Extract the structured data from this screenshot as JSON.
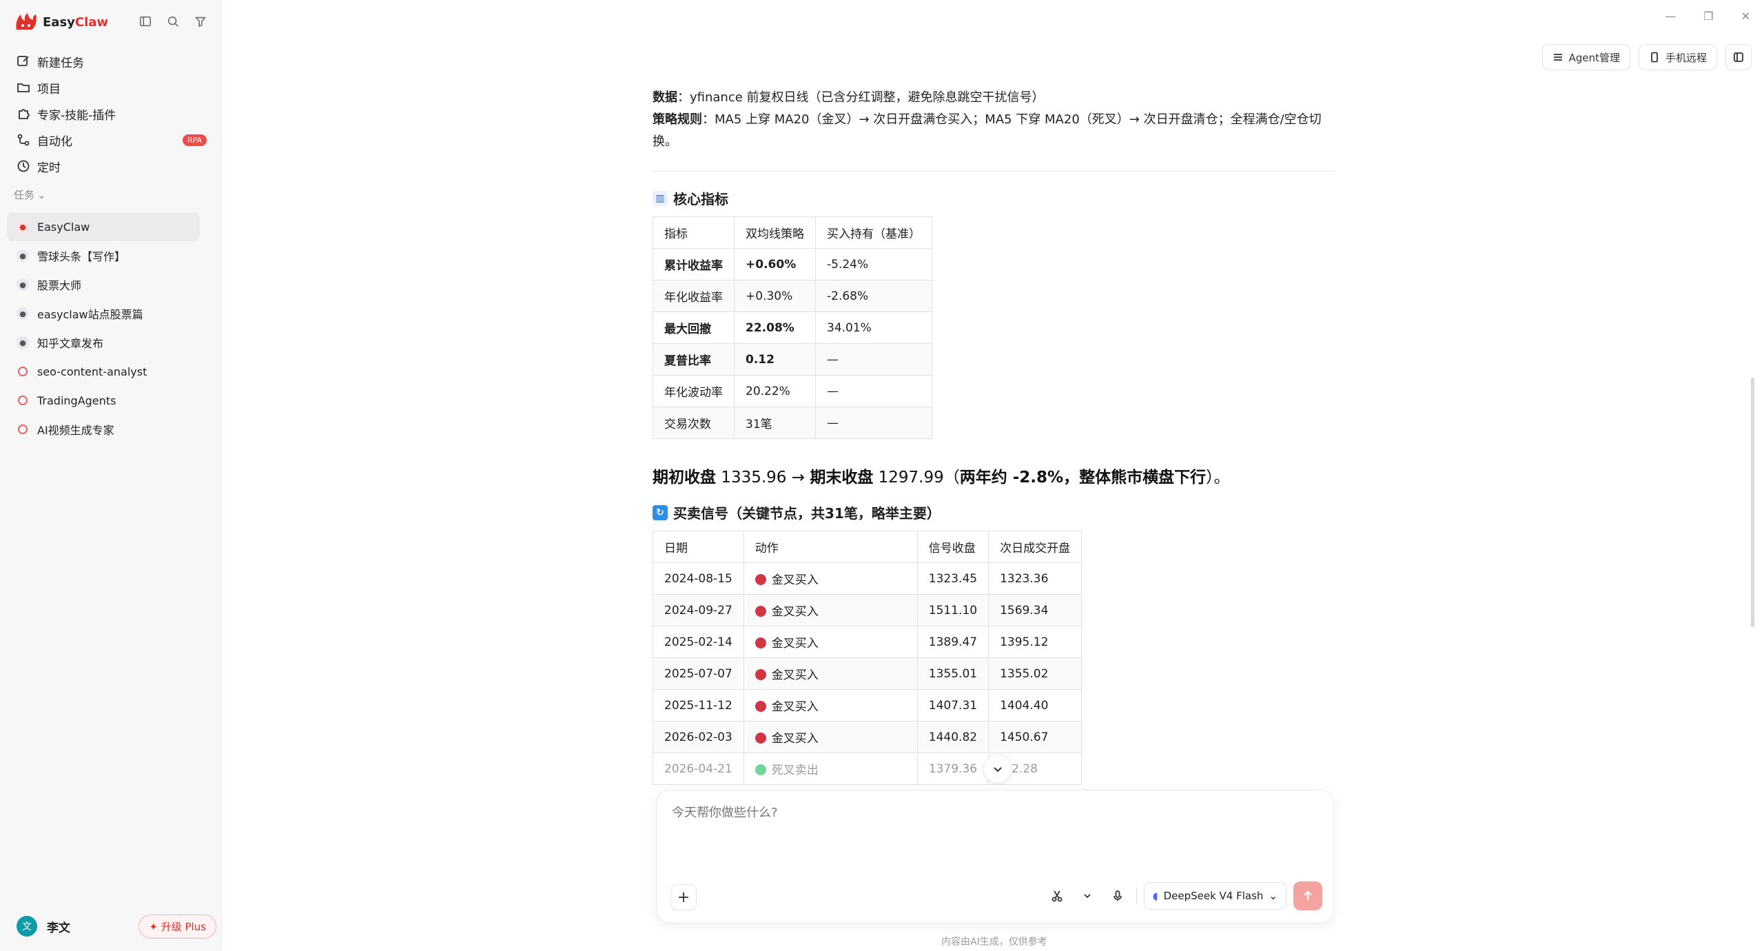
{
  "brand": {
    "name_a": "Easy",
    "name_b": "Claw"
  },
  "nav": [
    {
      "label": "新建任务",
      "icon": "new-task-icon"
    },
    {
      "label": "项目",
      "icon": "folder-icon"
    },
    {
      "label": "专家-技能-插件",
      "icon": "puzzle-icon"
    },
    {
      "label": "自动化",
      "icon": "automation-icon",
      "badge": "RPA"
    },
    {
      "label": "定时",
      "icon": "clock-icon"
    }
  ],
  "tasks_section_label": "任务",
  "tasks": [
    {
      "label": "EasyClaw",
      "avatar": "claw"
    },
    {
      "label": "雪球头条【写作】",
      "avatar": "person"
    },
    {
      "label": "股票大师",
      "avatar": "person"
    },
    {
      "label": "easyclaw站点股票篇",
      "avatar": "person"
    },
    {
      "label": "知乎文章发布",
      "avatar": "person"
    },
    {
      "label": "seo-content-analyst",
      "avatar": "dot"
    },
    {
      "label": "TradingAgents",
      "avatar": "dot"
    },
    {
      "label": "AI视频生成专家",
      "avatar": "dot"
    }
  ],
  "user": {
    "avatar_text": "文",
    "name": "李文",
    "upgrade": "升级 Plus"
  },
  "top_actions": {
    "agent": "Agent管理",
    "phone": "手机远程"
  },
  "content": {
    "data_label": "数据",
    "data_text": "：yfinance 前复权日线（已含分红调整，避免除息跳空干扰信号）",
    "rule_label": "策略规则",
    "rule_text": "：MA5 上穿 MA20（金叉）→ 次日开盘满仓买入；MA5 下穿 MA20（死叉）→ 次日开盘清仓；全程满仓/空仓切换。",
    "core_title": "核心指标",
    "core_headers": [
      "指标",
      "双均线策略",
      "买入持有（基准）"
    ],
    "core_rows": [
      {
        "cells": [
          "累计收益率",
          "+0.60%",
          "-5.24%"
        ],
        "bold": true
      },
      {
        "cells": [
          "年化收益率",
          "+0.30%",
          "-2.68%"
        ],
        "bold": false
      },
      {
        "cells": [
          "最大回撤",
          "22.08%",
          "34.01%"
        ],
        "bold": true
      },
      {
        "cells": [
          "夏普比率",
          "0.12",
          "—"
        ],
        "bold": true
      },
      {
        "cells": [
          "年化波动率",
          "20.22%",
          "—"
        ],
        "bold": false
      },
      {
        "cells": [
          "交易次数",
          "31笔",
          "—"
        ],
        "bold": false
      }
    ],
    "summary_a": "期初收盘",
    "summary_b": " 1335.96 → ",
    "summary_c": "期末收盘",
    "summary_d": " 1297.99（",
    "summary_e": "两年约 -2.8%，整体熊市横盘下行",
    "summary_f": "）。",
    "signals_title": "买卖信号（关键节点，共31笔，略举主要）",
    "signal_headers": [
      "日期",
      "动作",
      "信号收盘",
      "次日成交开盘"
    ],
    "signal_rows": [
      {
        "date": "2024-08-15",
        "action": "金叉买入",
        "type": "buy",
        "close": "1323.45",
        "open": "1323.36"
      },
      {
        "date": "2024-09-27",
        "action": "金叉买入",
        "type": "buy",
        "close": "1511.10",
        "open": "1569.34"
      },
      {
        "date": "2025-02-14",
        "action": "金叉买入",
        "type": "buy",
        "close": "1389.47",
        "open": "1395.12"
      },
      {
        "date": "2025-07-07",
        "action": "金叉买入",
        "type": "buy",
        "close": "1355.01",
        "open": "1355.02"
      },
      {
        "date": "2025-11-12",
        "action": "金叉买入",
        "type": "buy",
        "close": "1407.31",
        "open": "1404.40"
      },
      {
        "date": "2026-02-03",
        "action": "金叉买入",
        "type": "buy",
        "close": "1440.82",
        "open": "1450.67"
      },
      {
        "date": "2026-04-21",
        "action": "死叉卖出",
        "type": "sell",
        "close": "1379.36",
        "open": "…2.28"
      }
    ]
  },
  "composer": {
    "placeholder": "今天帮你做些什么?",
    "model": "DeepSeek V4 Flash"
  },
  "disclaimer": "内容由AI生成，仅供参考",
  "colors": {
    "accent": "#e0302a",
    "buy": "#d23544",
    "sell": "#6ed69b"
  }
}
